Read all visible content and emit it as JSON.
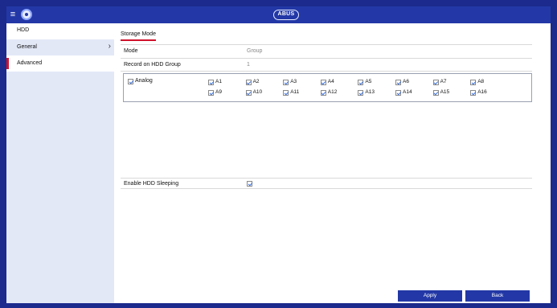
{
  "header": {
    "logo_text": "ABUS"
  },
  "sidebar": {
    "title": "HDD",
    "items": [
      {
        "label": "General",
        "chevron": "›"
      },
      {
        "label": "Advanced"
      }
    ]
  },
  "main": {
    "tab_label": "Storage Mode",
    "rows": [
      {
        "key": "Mode",
        "value": "Group"
      },
      {
        "key": "Record on HDD Group",
        "value": "1"
      }
    ],
    "analog": {
      "label": "Analog",
      "checked": true,
      "channels": [
        {
          "label": "A1",
          "checked": true
        },
        {
          "label": "A2",
          "checked": true
        },
        {
          "label": "A3",
          "checked": true
        },
        {
          "label": "A4",
          "checked": true
        },
        {
          "label": "A5",
          "checked": true
        },
        {
          "label": "A6",
          "checked": true
        },
        {
          "label": "A7",
          "checked": true
        },
        {
          "label": "A8",
          "checked": true
        },
        {
          "label": "A9",
          "checked": true
        },
        {
          "label": "A10",
          "checked": true
        },
        {
          "label": "A11",
          "checked": true
        },
        {
          "label": "A12",
          "checked": true
        },
        {
          "label": "A13",
          "checked": true
        },
        {
          "label": "A14",
          "checked": true
        },
        {
          "label": "A15",
          "checked": true
        },
        {
          "label": "A16",
          "checked": true
        }
      ]
    },
    "sleep": {
      "label": "Enable HDD Sleeping",
      "checked": true
    },
    "buttons": {
      "apply": "Apply",
      "back": "Back"
    }
  },
  "colors": {
    "brand": "#2338a6",
    "frame": "#1b2a8c",
    "accent": "#d0112b",
    "sidebar_bg": "#e3e8f7"
  }
}
